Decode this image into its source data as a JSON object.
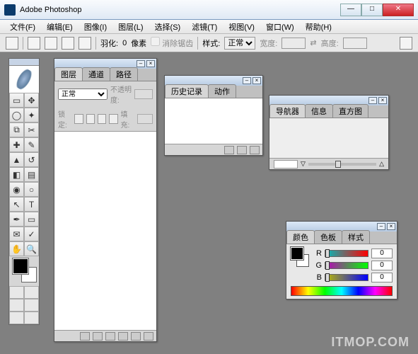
{
  "window": {
    "title": "Adobe Photoshop"
  },
  "menu": {
    "file": "文件(F)",
    "edit": "编辑(E)",
    "image": "图像(I)",
    "layer": "图层(L)",
    "select": "选择(S)",
    "filter": "滤镜(T)",
    "view": "视图(V)",
    "window": "窗口(W)",
    "help": "帮助(H)"
  },
  "options": {
    "feather_label": "羽化:",
    "feather_value": "0",
    "feather_unit": "像素",
    "antialias": "消除锯齿",
    "style_label": "样式:",
    "style_value": "正常",
    "width_label": "宽度:",
    "height_label": "高度:"
  },
  "panels": {
    "layers": {
      "tabs": [
        "图层",
        "通道",
        "路径"
      ],
      "blend": "正常",
      "opacity_label": "不透明度:",
      "lock_label": "锁定:",
      "fill_label": "填充:"
    },
    "history": {
      "tabs": [
        "历史记录",
        "动作"
      ]
    },
    "navigator": {
      "tabs": [
        "导航器",
        "信息",
        "直方图"
      ]
    },
    "color": {
      "tabs": [
        "颜色",
        "色板",
        "样式"
      ],
      "r_label": "R",
      "g_label": "G",
      "b_label": "B",
      "r_val": "0",
      "g_val": "0",
      "b_val": "0"
    }
  },
  "watermark": "ITMOP.COM"
}
